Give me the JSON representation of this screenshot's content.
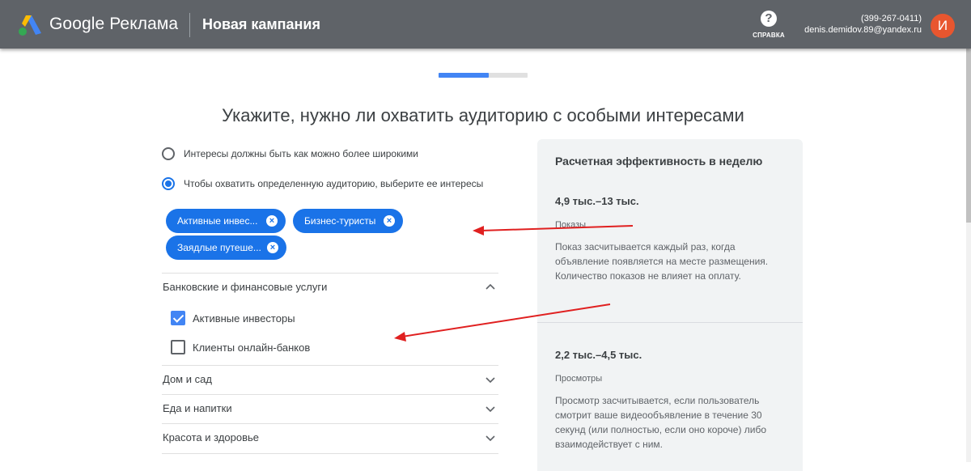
{
  "header": {
    "brand": "Google Реклама",
    "page_title": "Новая кампания",
    "help_label": "СПРАВКА",
    "account_phone": "(399-267-0411)",
    "account_email": "denis.demidov.89@yandex.ru",
    "avatar_letter": "И",
    "avatar_color": "#e8562f",
    "bar_color": "#5f6368"
  },
  "progress": {
    "fraction": 0.56,
    "color": "#4285f4"
  },
  "main": {
    "title": "Укажите, нужно ли охватить аудиторию с особыми интересами"
  },
  "radios": [
    {
      "label": "Интересы должны быть как можно более широкими",
      "selected": false
    },
    {
      "label": "Чтобы охватить определенную аудиторию, выберите ее интересы",
      "selected": true
    }
  ],
  "chips": [
    {
      "label": "Активные инвес..."
    },
    {
      "label": "Бизнес-туристы"
    },
    {
      "label": "Заядлые путеше..."
    }
  ],
  "categories": [
    {
      "label": "Банковские и финансовые услуги",
      "expanded": true,
      "items": [
        {
          "label": "Активные инвесторы",
          "checked": true
        },
        {
          "label": "Клиенты онлайн-банков",
          "checked": false
        }
      ]
    },
    {
      "label": "Дом и сад",
      "expanded": false
    },
    {
      "label": "Еда и напитки",
      "expanded": false
    },
    {
      "label": "Красота и здоровье",
      "expanded": false
    }
  ],
  "panel": {
    "title": "Расчетная эффективность в неделю",
    "metrics": [
      {
        "range": "4,9 тыс.–13 тыс.",
        "name": "Показы",
        "description": "Показ засчитывается каждый раз, когда объявление появляется на месте размещения. Количество показов не влияет на оплату."
      },
      {
        "range": "2,2 тыс.–4,5 тыс.",
        "name": "Просмотры",
        "description": "Просмотр засчитывается, если пользователь смотрит ваше видеообъявление в течение 30 секунд (или полностью, если оно короче) либо взаимодействует с ним."
      }
    ]
  },
  "annotation_color": "#e02020"
}
